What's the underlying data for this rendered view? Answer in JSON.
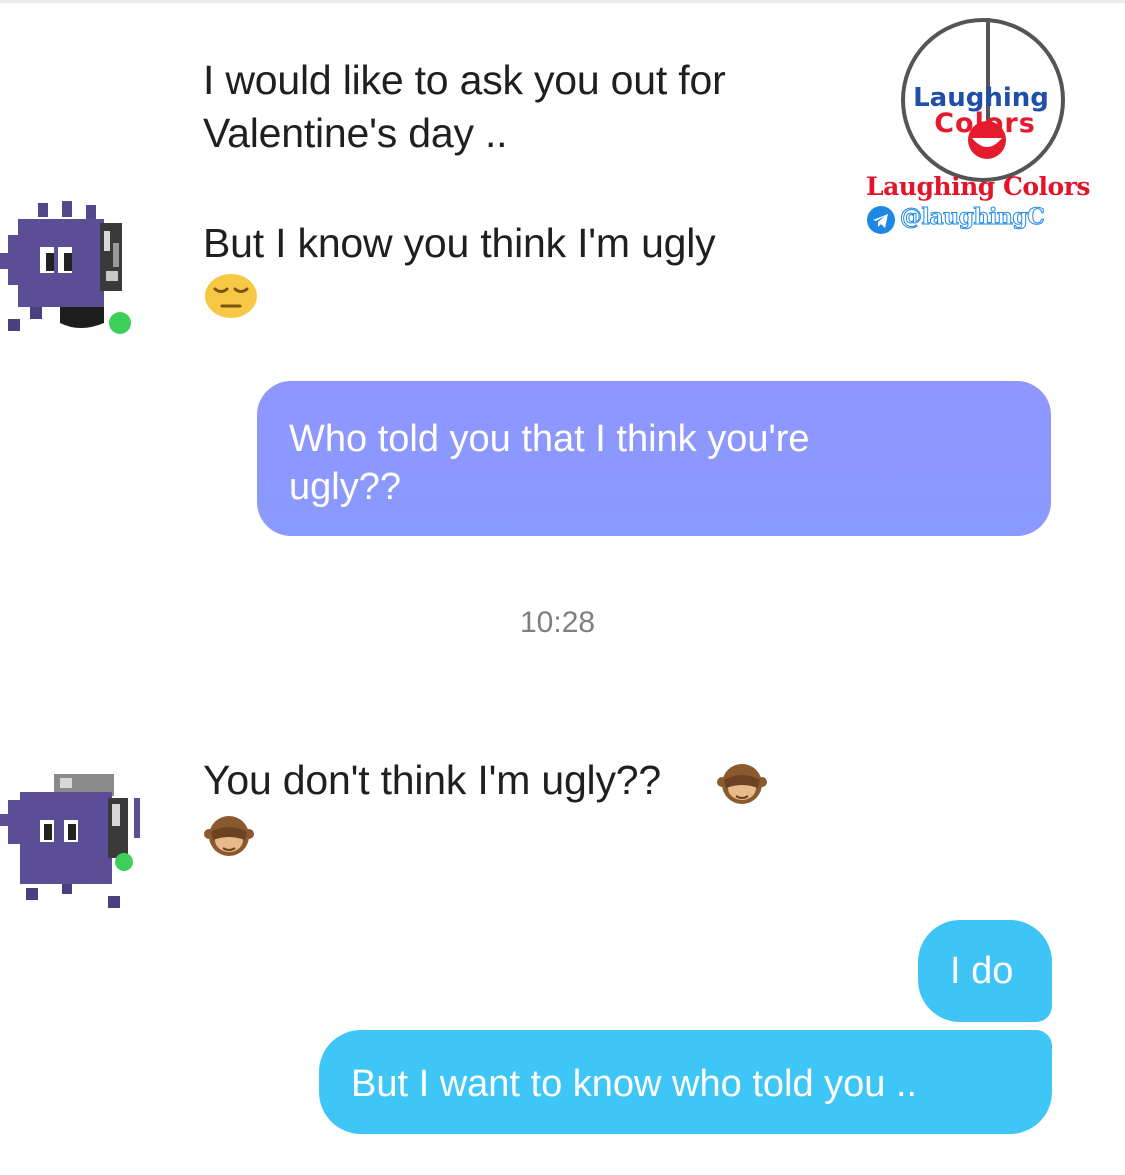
{
  "conversation": {
    "incoming_1_line1": "I would like to ask you out for",
    "incoming_1_line2": "Valentine's day ..",
    "incoming_2": "But I know you think I'm ugly",
    "outgoing_1_line1": "Who told you that I think you're",
    "outgoing_1_line2": "ugly??",
    "timestamp": "10:28",
    "incoming_3": "You don't think I'm ugly??",
    "outgoing_2": "I do",
    "outgoing_3": "But I want to know who told you .."
  },
  "watermark": {
    "logo_word_top": "Laughing",
    "logo_word_bottom": "Colors",
    "brand": "Laughing Colors",
    "handle": "@laughingC"
  },
  "icons": {
    "incoming_emoji": "expressionless-face-icon",
    "see_no_evil": "see-no-evil-monkey-icon",
    "telegram": "telegram-icon",
    "avatar": "pixel-monster-avatar-icon"
  },
  "colors": {
    "outgoing_purple": "#8b97ff",
    "outgoing_cyan": "#3ec6f6",
    "online_dot": "#3ecf5a",
    "brand_red": "#e2142a",
    "brand_blue": "#1e88e5"
  }
}
